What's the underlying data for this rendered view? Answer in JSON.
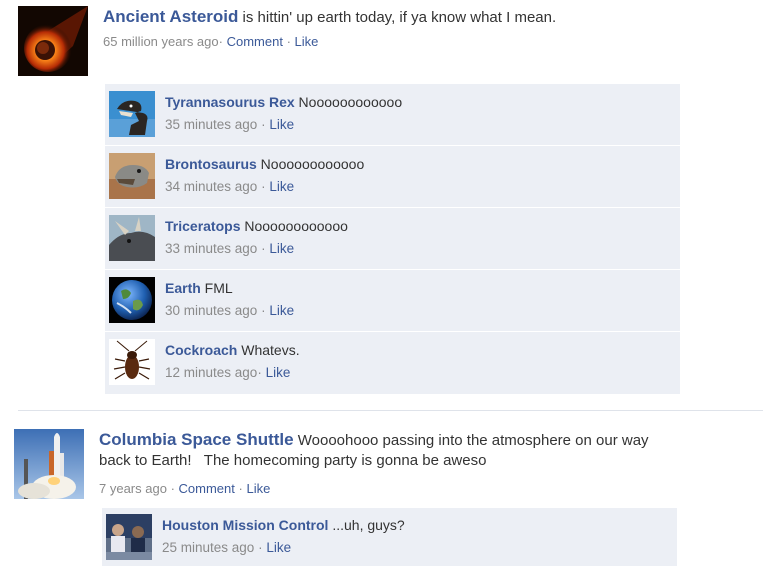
{
  "post1": {
    "author": "Ancient Asteroid",
    "text": " is hittin' up earth today, if ya know what I mean.",
    "time": "65 million years ago",
    "sep1": "·",
    "comment": "Comment",
    "sep2": "·",
    "like": "Like",
    "comments": [
      {
        "name": "Tyrannasourus Rex",
        "text": " Noooooooooooo",
        "time": "35 minutes ago",
        "sep": " ·",
        "like": "Like",
        "icon": "t-rex-avatar"
      },
      {
        "name": "Brontosaurus",
        "text": " Noooooooooooo",
        "time": "34 minutes ago",
        "sep": " ·",
        "like": "Like",
        "icon": "brontosaurus-avatar"
      },
      {
        "name": "Triceratops",
        "text": " Noooooooooooo",
        "time": "33 minutes ago",
        "sep": " ·",
        "like": "Like",
        "icon": "triceratops-avatar"
      },
      {
        "name": "Earth",
        "text": " FML",
        "time": "30 minutes ago",
        "sep": " ·",
        "like": "Like",
        "icon": "earth-avatar"
      },
      {
        "name": "Cockroach",
        "text": " Whatevs.",
        "time": "12 minutes ago",
        "sep": "·",
        "like": "Like",
        "icon": "cockroach-avatar"
      }
    ]
  },
  "post2": {
    "author": "Columbia Space Shuttle",
    "text_line1": " Woooohooo passing into the atmosphere on our way",
    "text_line2": "back to Earth!   The homecoming party is gonna be aweso",
    "time": "7 years ago",
    "sep1": "·",
    "comment": "Comment",
    "sep2": "·",
    "like": "Like",
    "comments": [
      {
        "name": "Houston Mission Control",
        "text": " ...uh, guys?",
        "time": "25 minutes ago",
        "sep": " ·",
        "like": "Like",
        "icon": "mission-control-avatar"
      }
    ]
  },
  "colors": {
    "link": "#3b5998",
    "meta": "#8a8a8a",
    "comment_bg": "#eceff5"
  }
}
